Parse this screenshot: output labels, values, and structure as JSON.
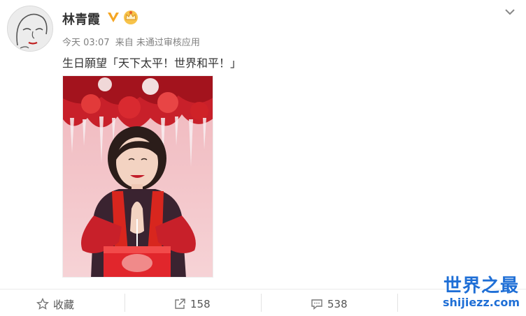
{
  "post": {
    "author": "林青霞",
    "time": "今天 03:07",
    "from_label": "来自",
    "source": "未通过审核应用",
    "text": "生日願望「天下太平！世界和平！」"
  },
  "icons": {
    "verified": "verified-v-icon",
    "crown": "crown-badge-icon",
    "menu": "chevron-down-icon",
    "favorite": "star-icon",
    "repost": "share-icon",
    "comment": "comment-icon"
  },
  "actions": {
    "favorite_label": "收藏",
    "repost_count": "158",
    "comment_count": "538"
  },
  "watermark": {
    "title": "世界之最",
    "url": "shijiezz.com"
  },
  "colors": {
    "verified": "#f5a623",
    "watermark": "#1f6fd6",
    "photo_background": "#f3c9cf",
    "scarf": "#d8261e"
  }
}
